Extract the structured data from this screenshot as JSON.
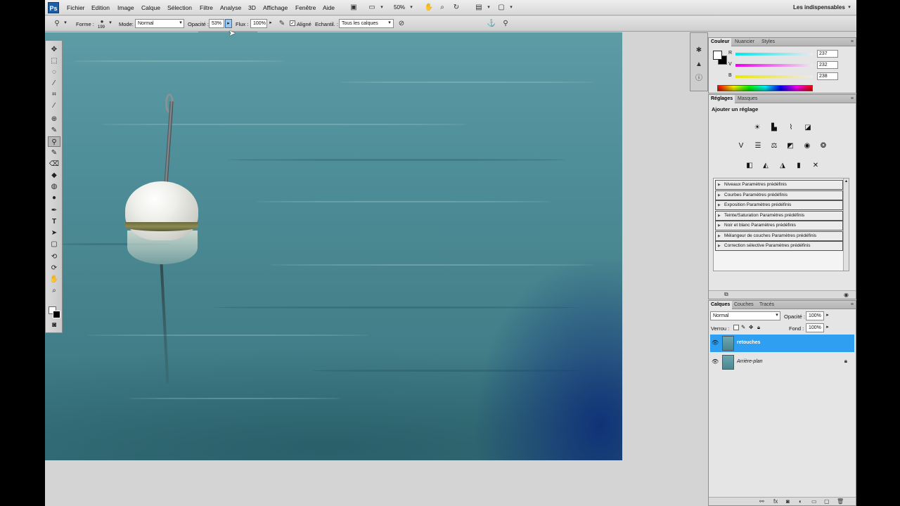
{
  "menubar": {
    "logo": "Ps",
    "items": [
      "Fichier",
      "Edition",
      "Image",
      "Calque",
      "Sélection",
      "Filtre",
      "Analyse",
      "3D",
      "Affichage",
      "Fenêtre",
      "Aide"
    ],
    "zoom": "50%",
    "workspace": "Les indispensables"
  },
  "options": {
    "forme_label": "Forme :",
    "brush_size": "199",
    "mode_label": "Mode:",
    "mode_value": "Normal",
    "opacity_label": "Opacité :",
    "opacity_value": "53%",
    "flux_label": "Flux :",
    "flux_value": "100%",
    "aligned_label": "Aligné",
    "sample_label": "Echantil. :",
    "sample_value": "Tous les calques",
    "opacity_slider_level": 0.53
  },
  "color_panel": {
    "tabs": [
      "Couleur",
      "Nuancier",
      "Styles"
    ],
    "r_label": "R",
    "v_label": "V",
    "b_label": "B",
    "r_value": "237",
    "v_value": "232",
    "b_value": "238",
    "fg_color": "#ffffff",
    "bg_color": "#000000"
  },
  "adjustments": {
    "tabs": [
      "Réglages",
      "Masques"
    ],
    "title": "Ajouter un réglage",
    "presets": [
      "Niveaux Paramètres prédéfinis",
      "Courbes Paramètres prédéfinis",
      "Exposition Paramètres prédéfinis",
      "Teinte/Saturation Paramètres prédéfinis",
      "Noir et blanc Paramètres prédéfinis",
      "Mélangeur de couches Paramètres prédéfinis",
      "Correction sélective Paramètres prédéfinis"
    ]
  },
  "layers": {
    "tabs": [
      "Calques",
      "Couches",
      "Tracés"
    ],
    "blend_mode": "Normal",
    "opacity_label": "Opacité :",
    "opacity_value": "100%",
    "lock_label": "Verrou :",
    "fill_label": "Fond :",
    "fill_value": "100%",
    "items": [
      {
        "name": "retouches",
        "selected": true
      },
      {
        "name": "Arrière-plan",
        "selected": false
      }
    ],
    "selection_color": "#2f9ff2"
  }
}
